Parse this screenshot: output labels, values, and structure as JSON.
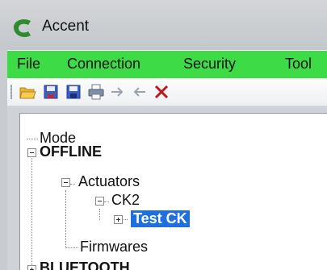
{
  "window": {
    "title": "Accent"
  },
  "menu": {
    "items": [
      "File",
      "Connection",
      "Security",
      "Tool"
    ]
  },
  "colors": {
    "menu_bar": "#3ddb45",
    "selection": "#1f6fe0",
    "logo": "#2e8b2e"
  },
  "toolbar": {
    "icons": [
      "open-folder-icon",
      "export-icon",
      "save-icon",
      "print-icon",
      "arrow-right-icon",
      "arrow-left-icon",
      "delete-x-icon"
    ]
  },
  "tree": {
    "nodes": [
      {
        "label": "Mode"
      },
      {
        "label": "OFFLINE"
      },
      {
        "label": "Actuators"
      },
      {
        "label": "CK2"
      },
      {
        "label": "Test CK",
        "selected": true
      },
      {
        "label": "Firmwares"
      },
      {
        "label": "BLUETOOTH"
      }
    ]
  }
}
